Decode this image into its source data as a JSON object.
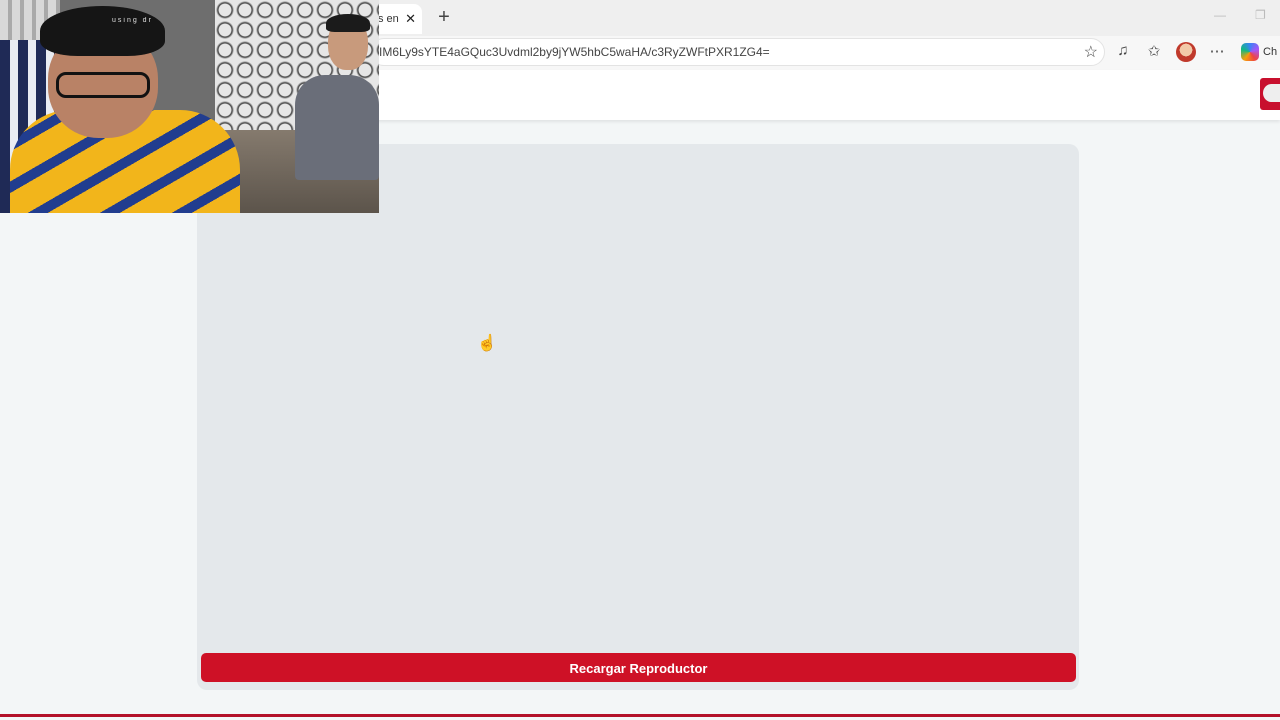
{
  "browser": {
    "tab_title": "s en",
    "tab_close_glyph": "✕",
    "new_tab_glyph": "+",
    "url": "IM6Ly9sYTE4aGQuc3Uvdml2by9jYW5hbC5waHA/c3RyZWFtPXR1ZG4=",
    "copilot_label": "Ch",
    "toolbar_icons": [
      "star-icon",
      "media-icon",
      "favorites-icon",
      "profile-avatar",
      "more-icon",
      "copilot-icon"
    ]
  },
  "webcam": {
    "watermark": "using dr"
  },
  "player": {
    "reload_button_label": "Recargar Reproductor",
    "accent_color": "#ce1126",
    "frame_color": "#e4e8eb"
  }
}
